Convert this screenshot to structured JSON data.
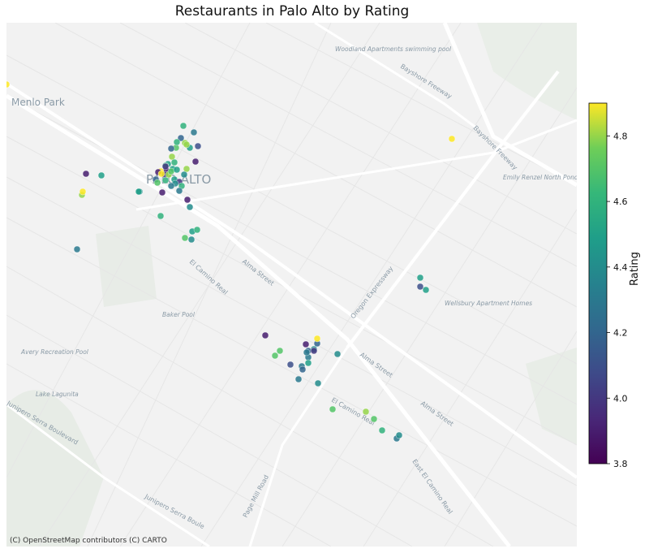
{
  "title": "Restaurants in Palo Alto by Rating",
  "attribution": "(C) OpenStreetMap contributors (C) CARTO",
  "colorbar": {
    "label": "Rating",
    "min": 3.8,
    "max": 4.9,
    "ticks": [
      "3.8",
      "4.0",
      "4.2",
      "4.4",
      "4.6",
      "4.8"
    ],
    "tick_values": [
      3.8,
      4.0,
      4.2,
      4.4,
      4.6,
      4.8
    ],
    "colormap": "viridis"
  },
  "map_labels": [
    {
      "name": "menlo-park-label",
      "text": "Menlo Park"
    },
    {
      "name": "palo-alto-label",
      "text": "PALO ALTO"
    },
    {
      "name": "woodland-apartments-label",
      "text": "Woodland Apartments swimming pool"
    },
    {
      "name": "emily-renzel-label",
      "text": "Emily Renzel North Pond"
    },
    {
      "name": "wellsbury-label",
      "text": "Wellsbury Apartment Homes"
    },
    {
      "name": "baker-pool-label",
      "text": "Baker Pool"
    },
    {
      "name": "avery-pool-label",
      "text": "Avery Recreation Pool"
    },
    {
      "name": "lake-lagunita-label",
      "text": "Lake Lagunita"
    },
    {
      "name": "alma-street-label-1",
      "text": "Alma Street"
    },
    {
      "name": "alma-street-label-2",
      "text": "Alma Street"
    },
    {
      "name": "alma-street-label-3",
      "text": "Alma Street"
    },
    {
      "name": "el-camino-real-label-1",
      "text": "El Camino Real"
    },
    {
      "name": "el-camino-real-label-2",
      "text": "El Camino Real"
    },
    {
      "name": "el-camino-real-label-3",
      "text": "East El Camino Real"
    },
    {
      "name": "oregon-expressway-label",
      "text": "Oregon Expressway"
    },
    {
      "name": "bayshore-label-1",
      "text": "Bayshore Freeway"
    },
    {
      "name": "bayshore-label-2",
      "text": "Bayshore Freeway"
    },
    {
      "name": "page-mill-label",
      "text": "Page Mill Road"
    },
    {
      "name": "junipero-label-1",
      "text": "Junipero Serra Boulevard"
    },
    {
      "name": "junipero-label-2",
      "text": "Junipero Serra Boule"
    }
  ],
  "chart_data": {
    "type": "scatter",
    "title": "Restaurants in Palo Alto by Rating",
    "color_variable": "Rating",
    "color_range": [
      3.8,
      4.9
    ],
    "points_rating": [
      4.9,
      4.5,
      4.4,
      3.9,
      4.8,
      4.6,
      4.5,
      4.1,
      4.8,
      4.3,
      3.9,
      4.2,
      4.8,
      4.7,
      4.6,
      4.2,
      4.8,
      4.5,
      4.6,
      4.5,
      3.9,
      4.9,
      4.0,
      3.9,
      4.2,
      4.7,
      4.8,
      4.5,
      4.0,
      4.6,
      4.4,
      4.3,
      3.9,
      4.3,
      4.9,
      4.7,
      4.6,
      4.5,
      4.8,
      4.4,
      4.6,
      4.0,
      3.9,
      4.4,
      4.5,
      4.6,
      4.9,
      4.3,
      4.7,
      4.5,
      4.6,
      4.4,
      4.9,
      3.9,
      4.7,
      4.7,
      4.3,
      4.1,
      3.9,
      4.2,
      4.3,
      4.4,
      4.2,
      4.3,
      4.9,
      4.5,
      4.4,
      4.0,
      4.2,
      4.3,
      4.4,
      4.7,
      4.5,
      4.1,
      4.5,
      4.8,
      4.7,
      4.6,
      4.3,
      4.4
    ]
  }
}
